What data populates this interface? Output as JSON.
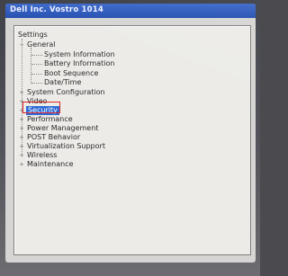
{
  "window": {
    "title": "Dell Inc. Vostro 1014"
  },
  "tree": {
    "root_label": "Settings",
    "general": {
      "label": "General",
      "expander": "−",
      "children": [
        "System Information",
        "Battery Information",
        "Boot Sequence",
        "Date/Time"
      ]
    },
    "collapsed_expander": "+",
    "items": [
      "System Configuration",
      "Video",
      "Security",
      "Performance",
      "Power Management",
      "POST Behavior",
      "Virtualization Support",
      "Wireless",
      "Maintenance"
    ],
    "selected_item": "Security"
  },
  "colors": {
    "titlebar": "#244fb1",
    "selection": "#2e6bd6",
    "annotation_box": "#e0262a"
  }
}
